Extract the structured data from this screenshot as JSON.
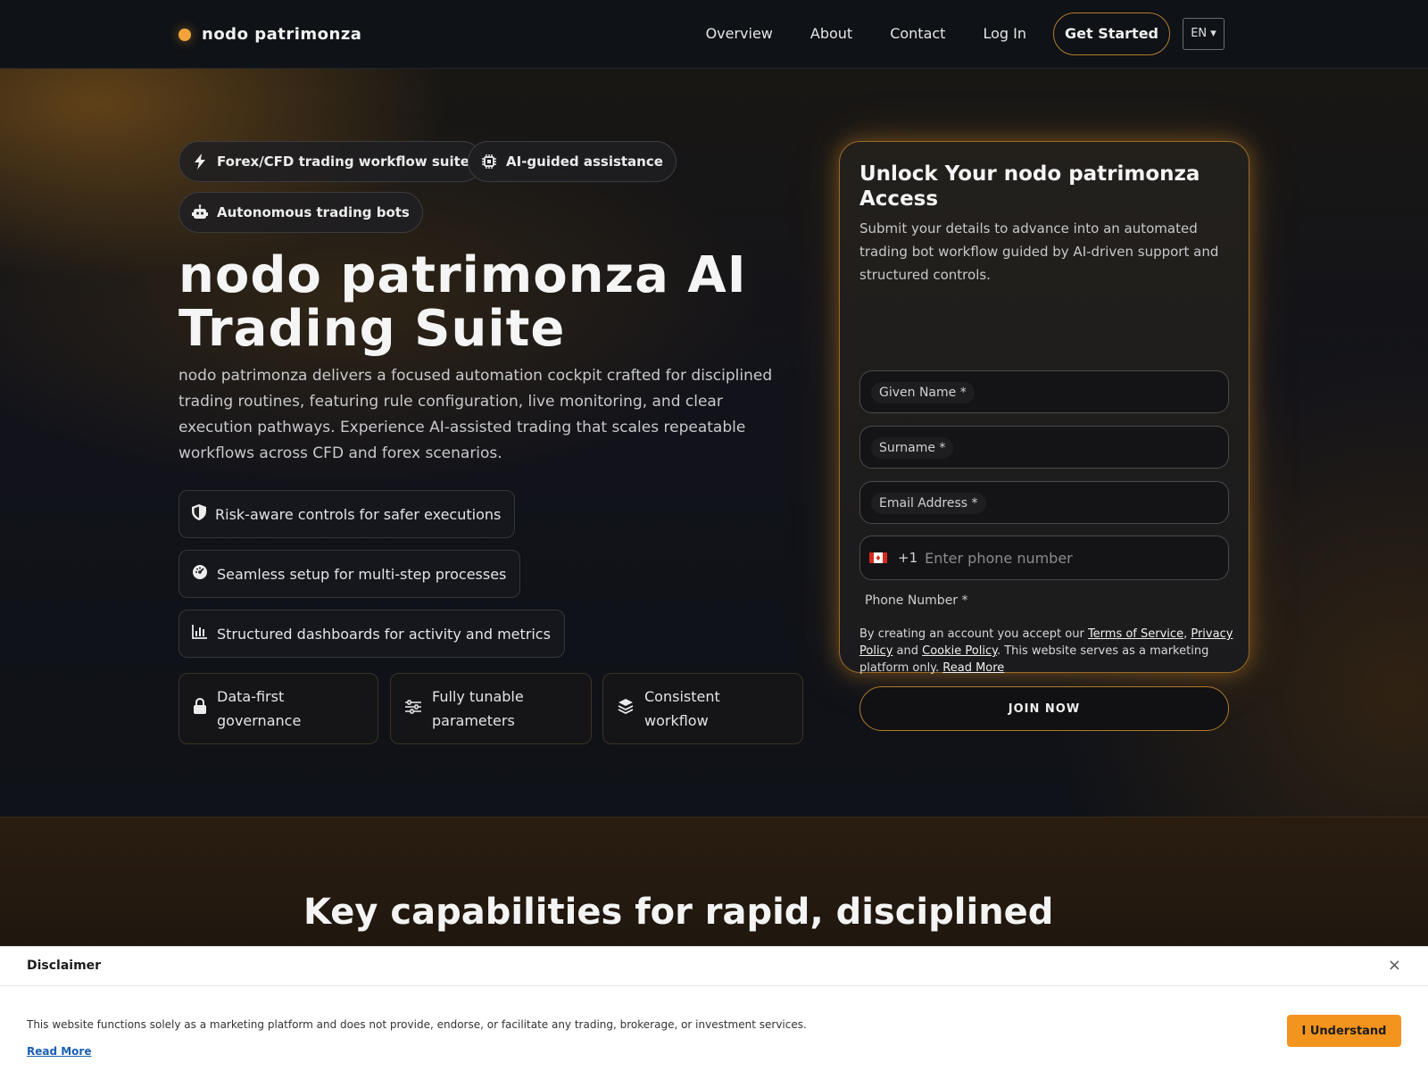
{
  "colors": {
    "accent": "#f2a43a",
    "background": "#0e1116",
    "button_orange": "#f2941d"
  },
  "header": {
    "brand": "nodo patrimonza",
    "nav": [
      "Overview",
      "About",
      "Contact",
      "Log In"
    ],
    "cta": "Get Started",
    "language": "EN ▾"
  },
  "hero": {
    "badges": [
      {
        "label": "Forex/CFD trading workflow suite",
        "icon": "lightning-icon"
      },
      {
        "label": "AI-guided assistance",
        "icon": "chip-icon"
      },
      {
        "label": "Autonomous trading bots",
        "icon": "robot-icon"
      }
    ],
    "title": "nodo patrimonza AI Trading Suite",
    "description": "nodo patrimonza delivers a focused automation cockpit crafted for disciplined trading routines, featuring rule configuration, live monitoring, and clear execution pathways. Experience AI-assisted trading that scales repeatable workflows across CFD and forex scenarios.",
    "features": [
      {
        "label": "Risk-aware controls for safer executions",
        "icon": "shield-icon"
      },
      {
        "label": "Seamless setup for multi-step processes",
        "icon": "gauge-icon"
      },
      {
        "label": "Structured dashboards for activity and metrics",
        "icon": "bar-chart-icon"
      }
    ],
    "tiles": [
      {
        "label": "Data-first governance",
        "icon": "lock-icon"
      },
      {
        "label": "Fully tunable parameters",
        "icon": "sliders-icon"
      },
      {
        "label": "Consistent workflow",
        "icon": "layers-icon"
      }
    ]
  },
  "form": {
    "title": "Unlock Your nodo patrimonza Access",
    "description": "Submit your details to advance into an automated trading bot workflow guided by AI-driven support and structured controls.",
    "fields": [
      "Given Name *",
      "Surname *",
      "Email Address *"
    ],
    "phone": {
      "dial_code": "+1",
      "placeholder": "Enter phone number",
      "label": "Phone Number *",
      "flag": "canada-flag-icon"
    },
    "terms": {
      "prefix": "By creating an account you accept our ",
      "tos": "Terms of Service",
      "comma": ",",
      "privacy": "Privacy Policy",
      "and": " and ",
      "cookie": "Cookie Policy",
      "suffix": ". This website serves as a marketing platform only. ",
      "read_more": "Read More"
    },
    "submit": "JOIN NOW"
  },
  "section2": {
    "title": "Key capabilities for rapid, disciplined"
  },
  "disclaimer": {
    "title": "Disclaimer",
    "close": "×",
    "text": "This website functions solely as a marketing platform and does not provide, endorse, or facilitate any trading, brokerage, or investment services.",
    "read_more": "Read More",
    "button": "I Understand"
  }
}
